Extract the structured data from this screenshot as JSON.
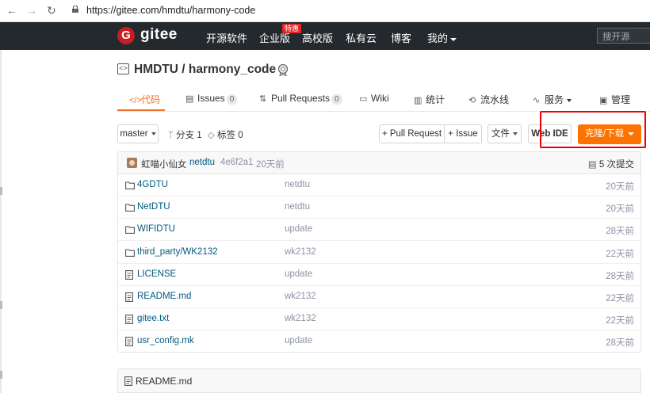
{
  "browser": {
    "url": "https://gitee.com/hmdtu/harmony-code"
  },
  "header": {
    "logo_letter": "G",
    "brand": "gitee",
    "nav": [
      "开源软件",
      "企业版",
      "高校版",
      "私有云",
      "博客",
      "我的"
    ],
    "badge": "特惠",
    "search_placeholder": "搜开源",
    "colors": {
      "bar": "#24292e",
      "logo": "#c71d23"
    }
  },
  "repo": {
    "title": "HMDTU / harmony_code"
  },
  "tabs": [
    {
      "label": "代码"
    },
    {
      "label": "Issues",
      "count": "0"
    },
    {
      "label": "Pull Requests",
      "count": "0"
    },
    {
      "label": "Wiki"
    },
    {
      "label": "统计"
    },
    {
      "label": "流水线"
    },
    {
      "label": "服务"
    },
    {
      "label": "管理"
    }
  ],
  "toolbar": {
    "branch": "master",
    "branches": "分支 1",
    "tags": "标签 0",
    "pull_request": "+ Pull Request",
    "issue": "+ Issue",
    "file": "文件",
    "web_ide": "Web IDE",
    "clone": "克隆/下载",
    "accent": "#fe7300"
  },
  "commit": {
    "author": "虹喵小仙女",
    "user": "netdtu",
    "hash": "4e6f2a1",
    "time": "20天前",
    "total": "5 次提交"
  },
  "files": [
    {
      "type": "folder",
      "name": "4GDTU",
      "message": "netdtu",
      "time": "20天前"
    },
    {
      "type": "folder",
      "name": "NetDTU",
      "message": "netdtu",
      "time": "20天前"
    },
    {
      "type": "folder",
      "name": "WIFIDTU",
      "message": "update",
      "time": "28天前"
    },
    {
      "type": "folder",
      "name": "third_party/WK2132",
      "message": "wk2132",
      "time": "22天前"
    },
    {
      "type": "file",
      "name": "LICENSE",
      "message": "update",
      "time": "28天前"
    },
    {
      "type": "file",
      "name": "README.md",
      "message": "wk2132",
      "time": "22天前"
    },
    {
      "type": "file",
      "name": "gitee.txt",
      "message": "wk2132",
      "time": "22天前"
    },
    {
      "type": "file",
      "name": "usr_config.mk",
      "message": "update",
      "time": "28天前"
    }
  ],
  "readme": {
    "title": "README.md"
  }
}
